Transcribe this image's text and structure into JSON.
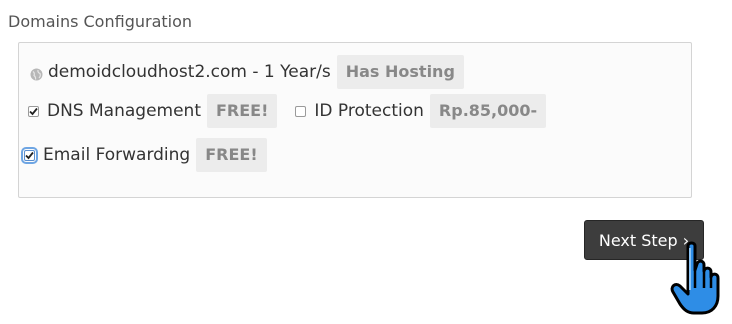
{
  "section": {
    "title": "Domains Configuration"
  },
  "domain": {
    "icon": "globe-icon",
    "text": "demoidcloudhost2.com - 1 Year/s",
    "hosting_badge": "Has Hosting"
  },
  "options": {
    "dns": {
      "label": "DNS Management",
      "badge": "FREE!",
      "checked": true
    },
    "id_protection": {
      "label": "ID Protection",
      "badge": "Rp.85,000-",
      "checked": false
    },
    "email_forwarding": {
      "label": "Email Forwarding",
      "badge": "FREE!",
      "checked": true
    }
  },
  "next_button": {
    "label": "Next Step ›"
  },
  "colors": {
    "button_bg": "#3d3d3d",
    "badge_bg": "#ececec",
    "cursor_fill": "#2e8de6"
  },
  "cursor": {
    "icon": "hand-pointer-icon"
  }
}
